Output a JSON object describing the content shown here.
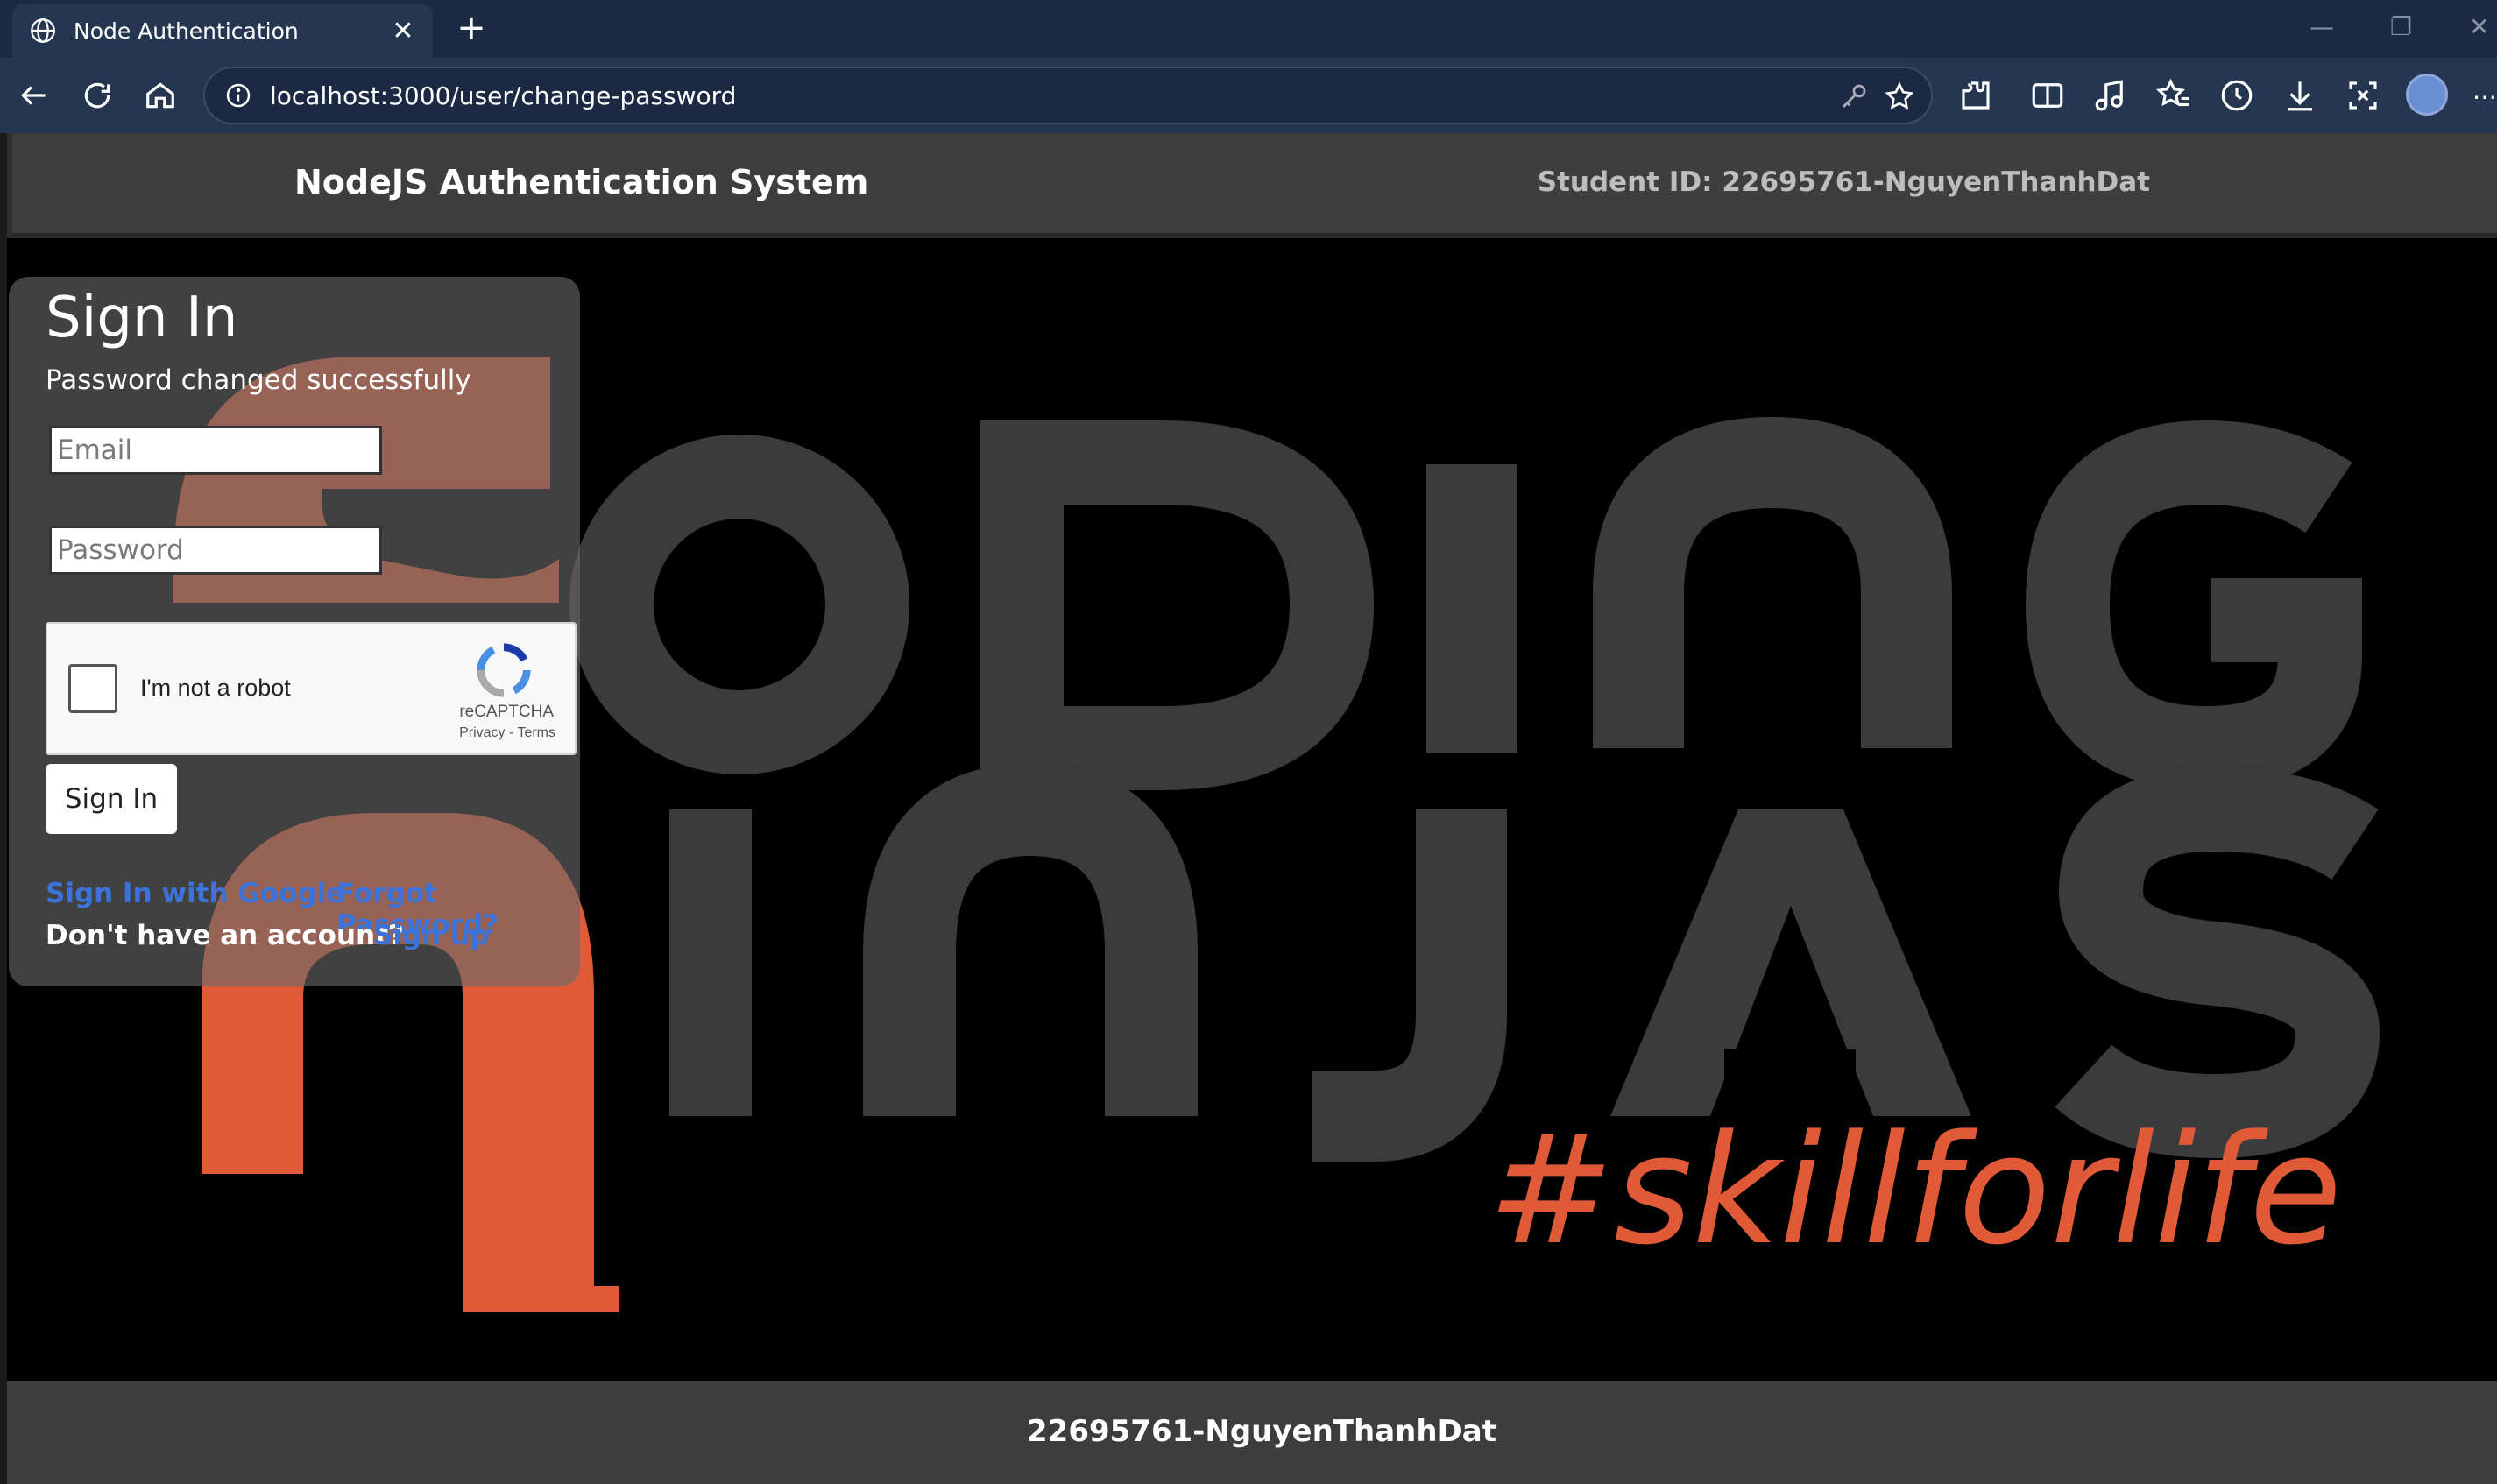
{
  "browser": {
    "tab_title": "Node Authentication",
    "url": "localhost:3000/user/change-password"
  },
  "header": {
    "brand": "NodeJS Authentication System",
    "student_id": "Student ID: 22695761-NguyenThanhDat"
  },
  "hero": {
    "tagline": "#skillforlife",
    "colors": {
      "orange": "#e05a38",
      "gray": "#3c3c3c"
    }
  },
  "signin": {
    "title": "Sign In",
    "message": "Password changed successfully",
    "email_placeholder": "Email",
    "password_placeholder": "Password",
    "captcha_label": "I'm not a robot",
    "captcha_brand": "reCAPTCHA",
    "captcha_links": "Privacy - Terms",
    "submit_label": "Sign In",
    "google_link": "Sign In with Google",
    "forgot_link": "Forgot Password?",
    "no_account": "Don't have an account?",
    "signup_link": "Sign up"
  },
  "footer": {
    "text": "22695761-NguyenThanhDat"
  }
}
